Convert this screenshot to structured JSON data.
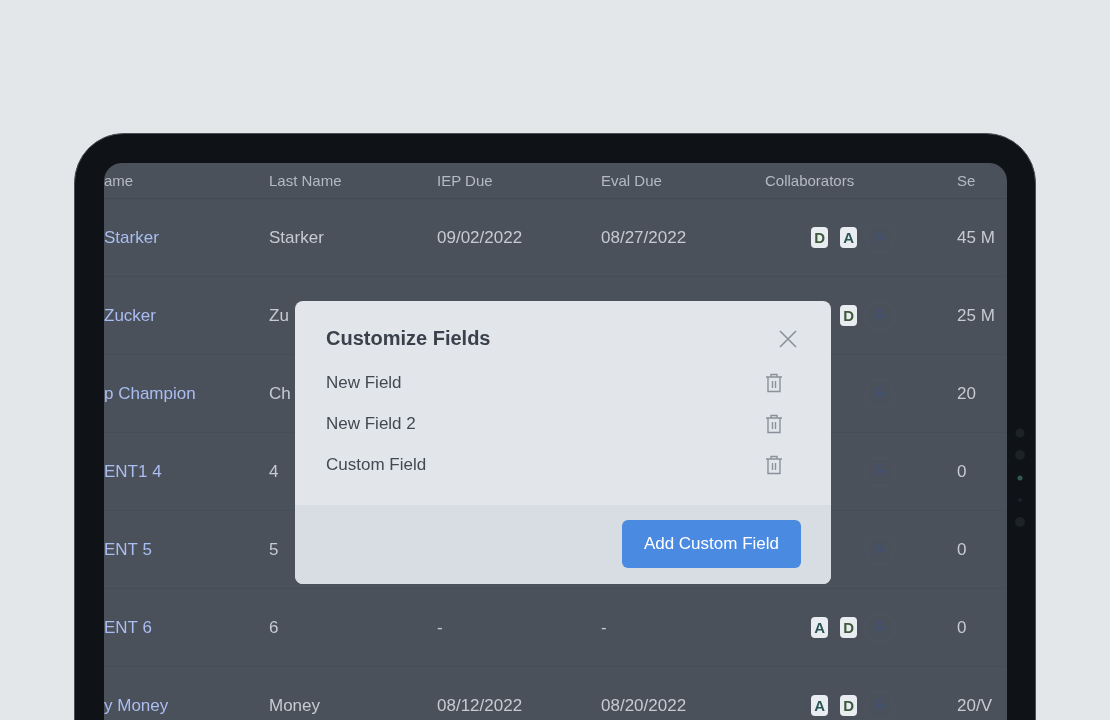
{
  "table": {
    "columns": [
      "ame",
      "Last Name",
      "IEP Due",
      "Eval Due",
      "Collaborators",
      "Se"
    ],
    "rows": [
      {
        "first_name": "Starker",
        "last_name": "Starker",
        "iep_due": "09/02/2022",
        "eval_due": "08/27/2022",
        "collaborators": [
          {
            "initial": "D",
            "color": "#3e5a3c"
          },
          {
            "initial": "A",
            "color": "#2c5656"
          }
        ],
        "column_6": "45 M"
      },
      {
        "first_name": "Zucker",
        "last_name": "Zu",
        "collaborators": [
          {
            "initial": "D",
            "color": "#3e5a3c"
          }
        ],
        "column_6": "25 M"
      },
      {
        "first_name": "p Champion",
        "last_name": "Ch",
        "collaborators": [],
        "column_6": "20"
      },
      {
        "first_name": "ENT1 4",
        "last_name": "4",
        "collaborators": [],
        "column_6": "0"
      },
      {
        "first_name": "ENT 5",
        "last_name": "5",
        "collaborators": [],
        "column_6": "0"
      },
      {
        "first_name": "ENT 6",
        "last_name": "6",
        "iep_due": "-",
        "eval_due": "-",
        "collaborators": [
          {
            "initial": "A",
            "color": "#2c5656"
          },
          {
            "initial": "D",
            "color": "#3e5a3c"
          }
        ],
        "column_6": "0"
      },
      {
        "first_name": "y Money",
        "last_name": "Money",
        "iep_due": "08/12/2022",
        "eval_due": "08/20/2022",
        "collaborators": [
          {
            "initial": "A",
            "color": "#2c5656"
          },
          {
            "initial": "D",
            "color": "#3e5a3c"
          }
        ],
        "column_6": "20/V"
      }
    ]
  },
  "dialog": {
    "title": "Customize Fields",
    "fields": [
      "New Field",
      "New Field 2",
      "Custom Field"
    ],
    "button": "Add Custom Field"
  }
}
